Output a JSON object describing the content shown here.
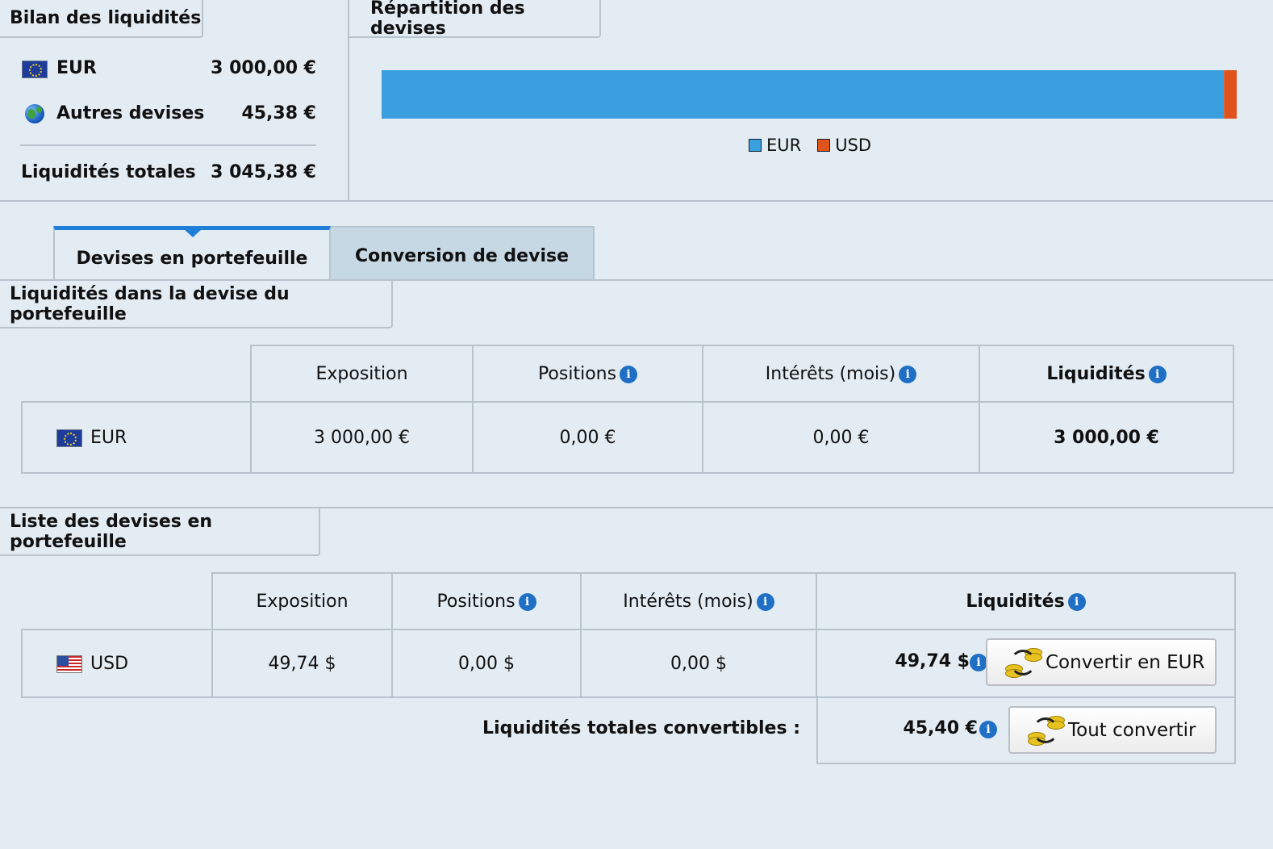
{
  "summary": {
    "title": "Bilan des liquidités",
    "rows": [
      {
        "currency": "EUR",
        "amount": "3 000,00 €"
      },
      {
        "currency": "Autres devises",
        "amount": "45,38 €"
      }
    ],
    "total_label": "Liquidités totales",
    "total_amount": "3 045,38 €"
  },
  "distribution": {
    "title": "Répartition des devises",
    "legend": [
      {
        "label": "EUR",
        "color": "#3a9fdf"
      },
      {
        "label": "USD",
        "color": "#e0531c"
      }
    ]
  },
  "chart_data": {
    "type": "bar",
    "orientation": "horizontal-stacked",
    "categories": [
      "EUR",
      "USD"
    ],
    "values": [
      3000.0,
      45.38
    ],
    "title": "Répartition des devises"
  },
  "tabs": [
    {
      "label": "Devises en portefeuille",
      "active": true
    },
    {
      "label": "Conversion de devise",
      "active": false
    }
  ],
  "portfolio_section": {
    "title": "Liquidités dans la devise du portefeuille",
    "headers": [
      "Exposition",
      "Positions",
      "Intérêts (mois)",
      "Liquidités"
    ],
    "row": {
      "currency": "EUR",
      "exposition": "3 000,00 €",
      "positions": "0,00 €",
      "interets": "0,00 €",
      "liquidites": "3 000,00 €"
    }
  },
  "list_section": {
    "title": "Liste des devises en portefeuille",
    "headers": [
      "Exposition",
      "Positions",
      "Intérêts (mois)",
      "Liquidités"
    ],
    "row": {
      "currency": "USD",
      "exposition": "49,74 $",
      "positions": "0,00 $",
      "interets": "0,00 $",
      "liquidites": "49,74 $"
    },
    "convert_button": "Convertir en EUR",
    "total_label": "Liquidités totales convertibles :",
    "total_amount": "45,40 €",
    "convert_all_button": "Tout convertir"
  },
  "icons": {
    "info": "i"
  }
}
